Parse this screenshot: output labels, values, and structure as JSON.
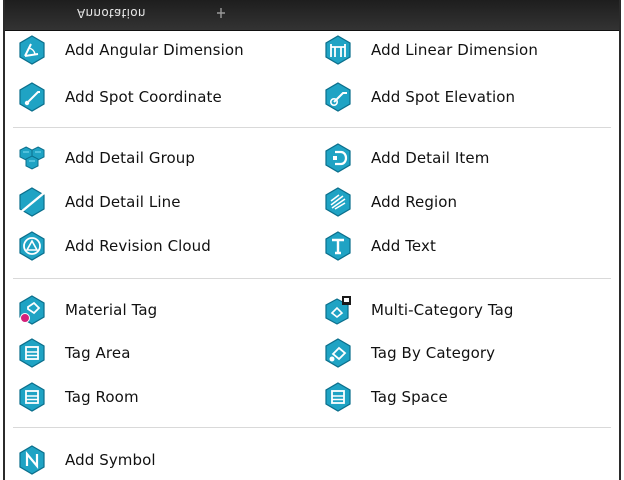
{
  "panel": {
    "title": "Annotation"
  },
  "items": {
    "angular_dimension": {
      "label": "Add Angular Dimension",
      "icon": "angular-dimension-icon"
    },
    "linear_dimension": {
      "label": "Add Linear Dimension",
      "icon": "linear-dimension-icon"
    },
    "spot_coordinate": {
      "label": "Add Spot Coordinate",
      "icon": "spot-coordinate-icon"
    },
    "spot_elevation": {
      "label": "Add Spot Elevation",
      "icon": "spot-elevation-icon"
    },
    "detail_group": {
      "label": "Add Detail Group",
      "icon": "detail-group-icon"
    },
    "detail_item": {
      "label": "Add Detail Item",
      "icon": "detail-item-icon"
    },
    "detail_line": {
      "label": "Add Detail Line",
      "icon": "detail-line-icon"
    },
    "region": {
      "label": "Add Region",
      "icon": "region-icon"
    },
    "revision_cloud": {
      "label": "Add Revision Cloud",
      "icon": "revision-cloud-icon"
    },
    "text": {
      "label": "Add Text",
      "icon": "text-icon"
    },
    "material_tag": {
      "label": "Material Tag",
      "icon": "material-tag-icon"
    },
    "multi_category_tag": {
      "label": "Multi-Category Tag",
      "icon": "multi-category-tag-icon"
    },
    "tag_area": {
      "label": "Tag Area",
      "icon": "tag-area-icon"
    },
    "tag_by_category": {
      "label": "Tag By Category",
      "icon": "tag-by-category-icon"
    },
    "tag_room": {
      "label": "Tag Room",
      "icon": "tag-room-icon"
    },
    "tag_space": {
      "label": "Tag Space",
      "icon": "tag-space-icon"
    },
    "symbol": {
      "label": "Add Symbol",
      "icon": "symbol-icon"
    }
  },
  "colors": {
    "icon_teal": "#1fa3c4",
    "icon_dark": "#0b6f8c",
    "icon_highlight": "#6fd3ea",
    "accent_magenta": "#d4217a",
    "titlebar": "#2a2a2a"
  }
}
